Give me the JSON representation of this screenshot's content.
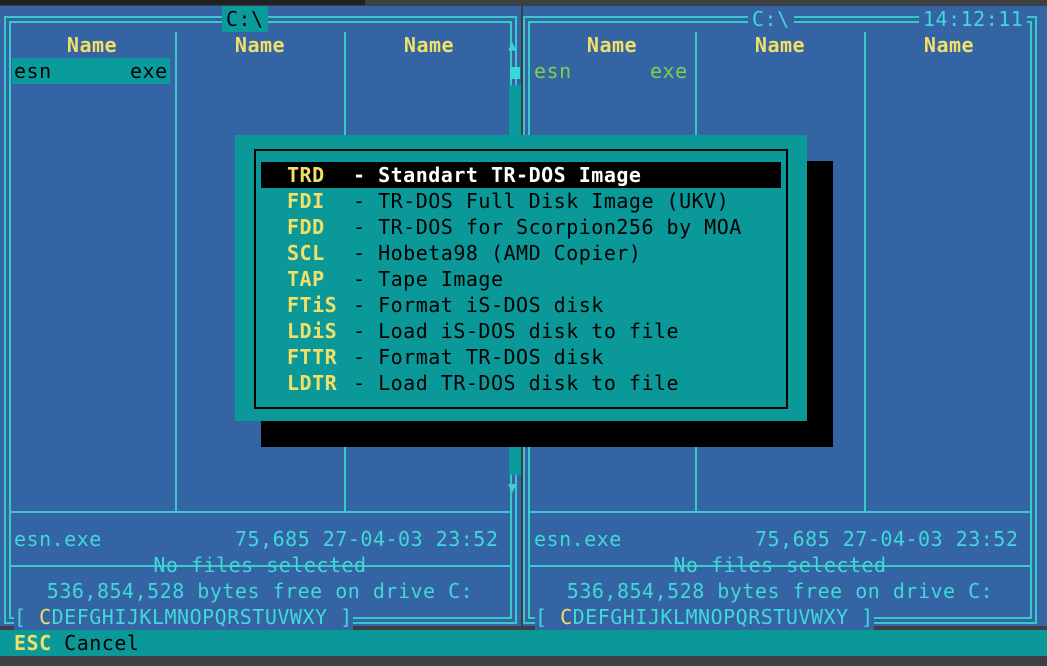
{
  "clock": "14:12:11",
  "left_panel": {
    "path": "C:\\",
    "columns": [
      "Name",
      "Name",
      "Name"
    ],
    "file": {
      "name": "esn",
      "ext": "exe"
    },
    "info_name": "esn.exe",
    "info_details": "75,685 27-04-03 23:52",
    "selected_status": "No files selected",
    "free_space": "536,854,528 bytes free on drive C:",
    "drives_prefix": "[ ",
    "drives_current": "C",
    "drives_rest": "DEFGHIJKLMNOPQRSTUVWXY ]"
  },
  "right_panel": {
    "path": "C:\\",
    "columns": [
      "Name",
      "Name",
      "Name"
    ],
    "file": {
      "name": "esn",
      "ext": "exe"
    },
    "info_name": "esn.exe",
    "info_details": "75,685 27-04-03 23:52",
    "selected_status": "No files selected",
    "free_space": "536,854,528 bytes free on drive C:",
    "drives_prefix": "[ ",
    "drives_current": "C",
    "drives_rest": "DEFGHIJKLMNOPQRSTUVWXY ]"
  },
  "dialog": {
    "options": [
      {
        "code": "TRD",
        "desc": "- Standart TR-DOS Image"
      },
      {
        "code": "FDI",
        "desc": "- TR-DOS Full Disk Image (UKV)"
      },
      {
        "code": "FDD",
        "desc": "- TR-DOS for Scorpion256 by MOA"
      },
      {
        "code": "SCL",
        "desc": "- Hobeta98 (AMD Copier)"
      },
      {
        "code": "TAP",
        "desc": "- Tape Image"
      },
      {
        "code": "FTiS",
        "desc": "- Format iS-DOS disk"
      },
      {
        "code": "LDiS",
        "desc": "- Load iS-DOS disk to file"
      },
      {
        "code": "FTTR",
        "desc": "- Format TR-DOS disk"
      },
      {
        "code": "LDTR",
        "desc": "- Load TR-DOS disk to file"
      }
    ]
  },
  "keybar": {
    "key": "ESC",
    "label": "Cancel"
  }
}
